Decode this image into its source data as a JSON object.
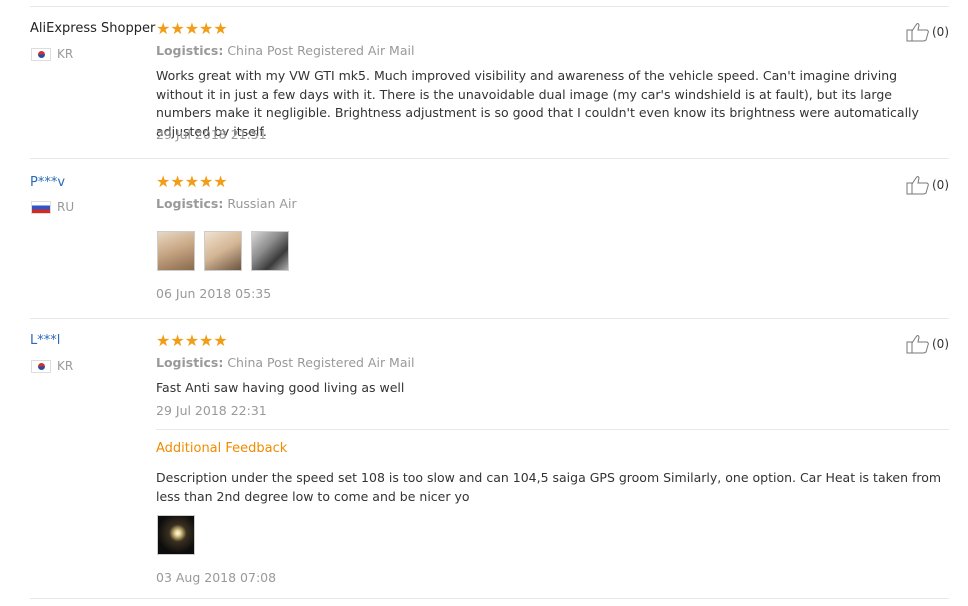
{
  "reviews": [
    {
      "name": "AliExpress Shopper",
      "country": "KR",
      "stars": "★★★★★",
      "logistics_label": "Logistics:",
      "logistics_value": "China Post Registered Air Mail",
      "feedback": "Works great with my VW GTI mk5. Much improved visibility and awareness of the vehicle speed. Can't imagine driving without it in just a few days with it. There is the unavoidable dual image (my car's windshield is at fault), but its large numbers make it negligible. Brightness adjustment is so good that I couldn't even know its brightness were automatically adjusted by itself.",
      "date": "29 Jul 2018 21:51",
      "helpful": "(0)"
    },
    {
      "name": "P***v",
      "country": "RU",
      "stars": "★★★★★",
      "logistics_label": "Logistics:",
      "logistics_value": "Russian Air",
      "date": "06 Jun 2018 05:35",
      "helpful": "(0)"
    },
    {
      "name": "L***l",
      "country": "KR",
      "stars": "★★★★★",
      "logistics_label": "Logistics:",
      "logistics_value": "China Post Registered Air Mail",
      "feedback": "Fast Anti saw having good living as well",
      "date": "29 Jul 2018 22:31",
      "helpful": "(0)",
      "additional_title": "Additional Feedback",
      "additional_text": "Description under the speed set 108 is too slow and can 104,5 saiga GPS groom Similarly, one option. Car Heat is taken from less than 2nd degree low to come and be nicer yo",
      "additional_date": "03 Aug 2018 07:08"
    }
  ],
  "icons": {
    "helpful": "thumbs-up-icon",
    "star": "star-icon",
    "flag_kr": "korea-flag-icon",
    "flag_ru": "russia-flag-icon"
  },
  "colors": {
    "stars": "#f29d18",
    "masked_name": "#2a6ab8",
    "additional_title": "#f08c00",
    "muted": "#999999"
  }
}
